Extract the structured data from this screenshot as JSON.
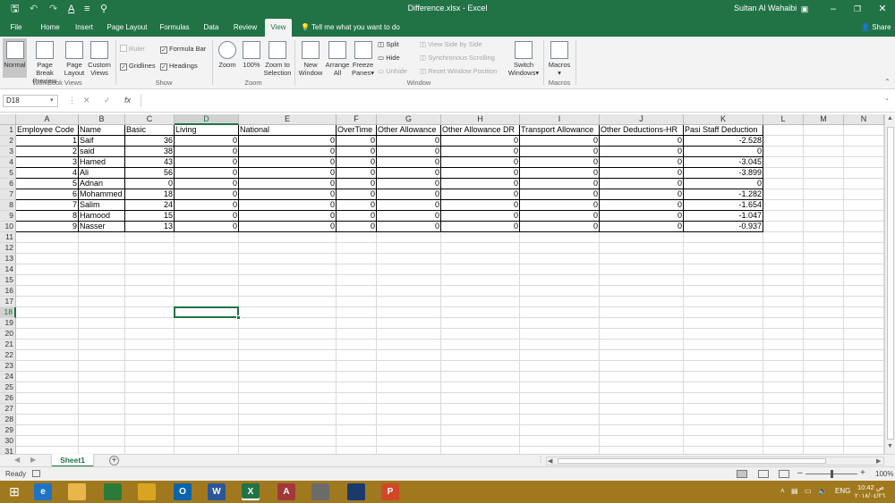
{
  "window": {
    "title": "Difference.xlsx - Excel",
    "user": "Sultan Al Wahaibi",
    "quick_access": {
      "save_icon": "save-icon",
      "undo_icon": "undo-icon",
      "redo_icon": "redo-icon",
      "font_color_icon": "font-color-icon",
      "customize_icon": "customize-icon"
    }
  },
  "tabs": [
    "File",
    "Home",
    "Insert",
    "Page Layout",
    "Formulas",
    "Data",
    "Review",
    "View"
  ],
  "active_tab": "View",
  "tell_me": "Tell me what you want to do",
  "share": "Share",
  "ribbon": {
    "workbook_views": {
      "label": "Workbook Views",
      "normal": "Normal",
      "page_break_1": "Page Break",
      "page_break_2": "Preview",
      "page_layout_1": "Page",
      "page_layout_2": "Layout",
      "custom_1": "Custom",
      "custom_2": "Views"
    },
    "show": {
      "label": "Show",
      "ruler": "Ruler",
      "formula_bar": "Formula Bar",
      "gridlines": "Gridlines",
      "headings": "Headings"
    },
    "zoom": {
      "label": "Zoom",
      "zoom": "Zoom",
      "hundred": "100%",
      "zoom_to_1": "Zoom to",
      "zoom_to_2": "Selection"
    },
    "window": {
      "label": "Window",
      "new_1": "New",
      "new_2": "Window",
      "arrange_1": "Arrange",
      "arrange_2": "All",
      "freeze_1": "Freeze",
      "freeze_2": "Panes",
      "split": "Split",
      "hide": "Hide",
      "unhide": "Unhide",
      "side_by_side": "View Side by Side",
      "sync_scroll": "Synchronous Scrolling",
      "reset_pos": "Reset Window Position",
      "switch_1": "Switch",
      "switch_2": "Windows"
    },
    "macros": {
      "label": "Macros",
      "macros": "Macros"
    }
  },
  "formula_bar": {
    "name_box": "D18",
    "cancel": "✕",
    "enter": "✓",
    "fx": "fx",
    "value": ""
  },
  "columns": [
    "A",
    "B",
    "C",
    "D",
    "E",
    "F",
    "G",
    "H",
    "I",
    "J",
    "K",
    "L",
    "M",
    "N"
  ],
  "headers": [
    "Employee Code",
    "Name",
    "Basic",
    "Living",
    "National",
    "OverTime",
    "Other Allowance",
    "Other Allowance DR",
    "Transport Allowance",
    "Other Deductions-HR",
    "Pasi Staff Deduction"
  ],
  "rows": [
    [
      "1",
      "Saif",
      "36",
      "0",
      "0",
      "0",
      "0",
      "0",
      "0",
      "0",
      "-2.528"
    ],
    [
      "2",
      "said",
      "38",
      "0",
      "0",
      "0",
      "0",
      "0",
      "0",
      "0",
      "0"
    ],
    [
      "3",
      "Hamed",
      "43",
      "0",
      "0",
      "0",
      "0",
      "0",
      "0",
      "0",
      "-3.045"
    ],
    [
      "4",
      "Ali",
      "56",
      "0",
      "0",
      "0",
      "0",
      "0",
      "0",
      "0",
      "-3.899"
    ],
    [
      "5",
      "Adnan",
      "0",
      "0",
      "0",
      "0",
      "0",
      "0",
      "0",
      "0",
      "0"
    ],
    [
      "6",
      "Mohammed",
      "18",
      "0",
      "0",
      "0",
      "0",
      "0",
      "0",
      "0",
      "-1.282"
    ],
    [
      "7",
      "Salim",
      "24",
      "0",
      "0",
      "0",
      "0",
      "0",
      "0",
      "0",
      "-1.654"
    ],
    [
      "8",
      "Hamood",
      "15",
      "0",
      "0",
      "0",
      "0",
      "0",
      "0",
      "0",
      "-1.047"
    ],
    [
      "9",
      "Nasser",
      "13",
      "0",
      "0",
      "0",
      "0",
      "0",
      "0",
      "0",
      "-0.937"
    ]
  ],
  "visible_row_count": 31,
  "selected_cell": "D18",
  "sheets": [
    "Sheet1"
  ],
  "add_sheet": "+",
  "status": {
    "ready": "Ready",
    "zoom": "100%"
  },
  "taskbar": {
    "apps": [
      {
        "name": "start",
        "icon": "windows-icon",
        "label": ""
      },
      {
        "name": "edge",
        "icon": "edge-icon",
        "label": "e"
      },
      {
        "name": "explorer",
        "icon": "folder-icon",
        "label": ""
      },
      {
        "name": "store",
        "icon": "store-icon",
        "label": ""
      },
      {
        "name": "chrome",
        "icon": "chrome-icon",
        "label": ""
      },
      {
        "name": "outlook",
        "icon": "outlook-icon",
        "label": "O"
      },
      {
        "name": "word",
        "icon": "word-icon",
        "label": "W"
      },
      {
        "name": "excel",
        "icon": "excel-icon",
        "label": "X"
      },
      {
        "name": "access",
        "icon": "access-icon",
        "label": "A"
      },
      {
        "name": "other",
        "icon": "app-icon",
        "label": ""
      },
      {
        "name": "dynamics",
        "icon": "dynamics-icon",
        "label": ""
      },
      {
        "name": "powerpoint",
        "icon": "powerpoint-icon",
        "label": "P"
      }
    ],
    "language": "ENG",
    "time": "10:42 ص",
    "date": "٢٠١٨/٠٤/٢٦"
  },
  "colors": {
    "excel_green": "#217346",
    "taskbar": "#a0791f",
    "ribbon_bg": "#f3f3f3"
  }
}
